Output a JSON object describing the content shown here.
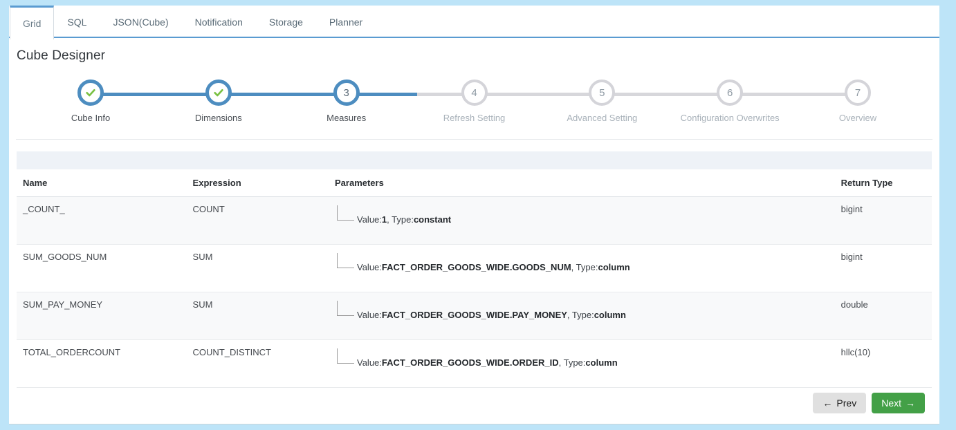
{
  "tabs": [
    {
      "label": "Grid",
      "active": true
    },
    {
      "label": "SQL",
      "active": false
    },
    {
      "label": "JSON(Cube)",
      "active": false
    },
    {
      "label": "Notification",
      "active": false
    },
    {
      "label": "Storage",
      "active": false
    },
    {
      "label": "Planner",
      "active": false
    }
  ],
  "page": {
    "title": "Cube Designer"
  },
  "stepper": {
    "current_step": 3,
    "total_steps": 7,
    "progress_percent": 42,
    "accent_color": "#4d8dc0",
    "inactive_color": "#d4d4d9",
    "check_color": "#7ac143",
    "steps": [
      {
        "number": "1",
        "label": "Cube Info",
        "state": "done",
        "icon": "check-icon"
      },
      {
        "number": "2",
        "label": "Dimensions",
        "state": "done",
        "icon": "check-icon"
      },
      {
        "number": "3",
        "label": "Measures",
        "state": "current",
        "icon": ""
      },
      {
        "number": "4",
        "label": "Refresh Setting",
        "state": "todo",
        "icon": ""
      },
      {
        "number": "5",
        "label": "Advanced Setting",
        "state": "todo",
        "icon": ""
      },
      {
        "number": "6",
        "label": "Configuration Overwrites",
        "state": "todo",
        "icon": ""
      },
      {
        "number": "7",
        "label": "Overview",
        "state": "todo",
        "icon": ""
      }
    ]
  },
  "table": {
    "columns": [
      "Name",
      "Expression",
      "Parameters",
      "Return Type"
    ],
    "rows": [
      {
        "name": "_COUNT_",
        "expression": "COUNT",
        "param_value_label": "Value:",
        "param_value": "1",
        "param_type_label": ", Type:",
        "param_type": "constant",
        "return_type": "bigint"
      },
      {
        "name": "SUM_GOODS_NUM",
        "expression": "SUM",
        "param_value_label": "Value:",
        "param_value": "FACT_ORDER_GOODS_WIDE.GOODS_NUM",
        "param_type_label": ", Type:",
        "param_type": "column",
        "return_type": "bigint"
      },
      {
        "name": "SUM_PAY_MONEY",
        "expression": "SUM",
        "param_value_label": "Value:",
        "param_value": "FACT_ORDER_GOODS_WIDE.PAY_MONEY",
        "param_type_label": ", Type:",
        "param_type": "column",
        "return_type": "double"
      },
      {
        "name": "TOTAL_ORDERCOUNT",
        "expression": "COUNT_DISTINCT",
        "param_value_label": "Value:",
        "param_value": "FACT_ORDER_GOODS_WIDE.ORDER_ID",
        "param_type_label": ", Type:",
        "param_type": "column",
        "return_type": "hllc(10)"
      }
    ]
  },
  "footer": {
    "prev_label": "Prev",
    "prev_arrow": "←",
    "next_label": "Next",
    "next_arrow": "→",
    "next_color": "#43a047",
    "prev_color": "#e0e0e0"
  }
}
